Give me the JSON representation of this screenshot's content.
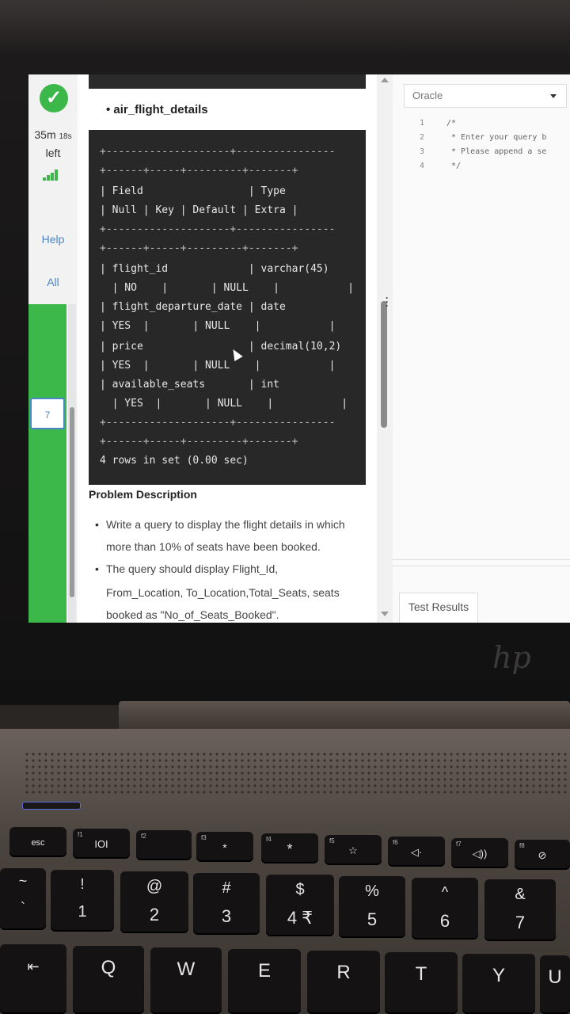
{
  "sidebar": {
    "timer_main": "35m",
    "timer_seconds": "18s",
    "timer_suffix": "left",
    "help": "Help",
    "all": "All",
    "active_question": "7"
  },
  "problem": {
    "table_title": "air_flight_details",
    "terminal_lines": [
      "+--------------------+----------------",
      "+------+-----+---------+-------+",
      "| Field                 | Type",
      "| Null | Key | Default | Extra |",
      "+--------------------+----------------",
      "+------+-----+---------+-------+",
      "| flight_id             | varchar(45)",
      "  | NO    |       | NULL    |           |",
      "| flight_departure_date | date",
      "| YES  |       | NULL    |           |",
      "| price                 | decimal(10,2)",
      "| YES  |       | NULL    |           |",
      "| available_seats       | int",
      "  | YES  |       | NULL    |           |",
      "+--------------------+----------------",
      "+------+-----+---------+-------+"
    ],
    "rows_result": "4 rows in set (0.00 sec)",
    "description_title": "Problem Description",
    "description_lines": [
      "Write a query to display the flight details in which",
      "more than 10% of seats have been booked.",
      "The query should display Flight_Id,",
      "From_Location, To_Location,Total_Seats, seats",
      "booked as \"No_of_Seats_Booked\"."
    ]
  },
  "editor": {
    "language": "Oracle",
    "line_numbers": [
      "1",
      "2",
      "3",
      "4"
    ],
    "code_lines": [
      "/*",
      " * Enter your query b",
      " * Please append a se",
      " */"
    ],
    "test_results": "Test Results"
  },
  "keyboard": {
    "function_row": [
      "esc",
      "IOI",
      "",
      "*",
      "*",
      "",
      "",
      "",
      ""
    ],
    "function_labels": [
      "",
      "f1",
      "f2",
      "f3",
      "f4",
      "f5",
      "f6",
      "f7",
      "f8"
    ],
    "number_row_top": [
      "~",
      "!",
      "@",
      "#",
      "$",
      "%",
      "^",
      "&"
    ],
    "number_row_bottom": [
      "`",
      "1",
      "2",
      "3",
      "4 ₹",
      "5",
      "6",
      "7"
    ],
    "letter_row": [
      "⇤",
      "Q",
      "W",
      "E",
      "R",
      "T",
      "Y",
      "U"
    ]
  }
}
